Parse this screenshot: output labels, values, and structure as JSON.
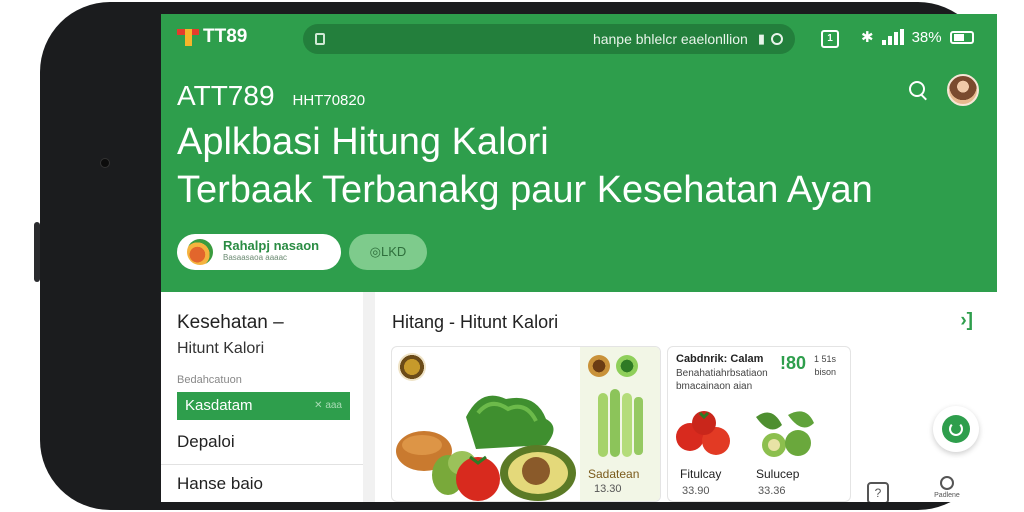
{
  "status_bar": {
    "brand": "TT89",
    "url": "hanpe bhlelcr eaelonllion",
    "sq_icon_label": "1",
    "battery": "38%"
  },
  "hero": {
    "app_name": "ATT789",
    "app_sub": "HHT70820",
    "headline_line1": "Aplkbasi Hitung Kalori",
    "headline_line2": "Terbaak Terbanakg paur Kesehatan Ayan",
    "chip1_main": "Rahalpj nasaon",
    "chip1_sub": "Basaasaoa aaaac",
    "chip2_label": "◎LKD"
  },
  "sidebar": {
    "title": "Kesehatan –",
    "subtitle": "Hitunt Kalori",
    "caption": "Bedahcatuon",
    "active_item": "Kasdatam",
    "active_close": "✕ aaa",
    "item1": "Depaloi",
    "item2": "Hanse baio"
  },
  "main": {
    "title": "Hitang - Hitunt Kalori",
    "arrow": "›]",
    "card1": {
      "label": "Sadatean",
      "value": "13.30"
    },
    "card2": {
      "title": "Cabdnrik: Calam",
      "sub": "Benahatiahrbsatiaon bmacainaon aian",
      "price": "!80",
      "unit_line1": "1 51s",
      "unit_line2": "bison",
      "item1_label": "Fitulcay",
      "item1_value": "33.90",
      "item2_label": "Sulucep",
      "item2_value": "33.36"
    },
    "help_label": "?",
    "profile_label": "Padlene"
  },
  "colors": {
    "brand_green": "#2e9e4c",
    "light_green": "#7ecb8c",
    "dark_green": "#237f3c"
  },
  "icons": [
    "brand-logo-icon",
    "lock-icon",
    "mic-icon",
    "circle-icon",
    "bluetooth-icon",
    "signal-icon",
    "battery-icon",
    "search-icon",
    "avatar",
    "fruit-icon",
    "arrow-icon",
    "refresh-icon",
    "help-icon",
    "profile-icon"
  ]
}
